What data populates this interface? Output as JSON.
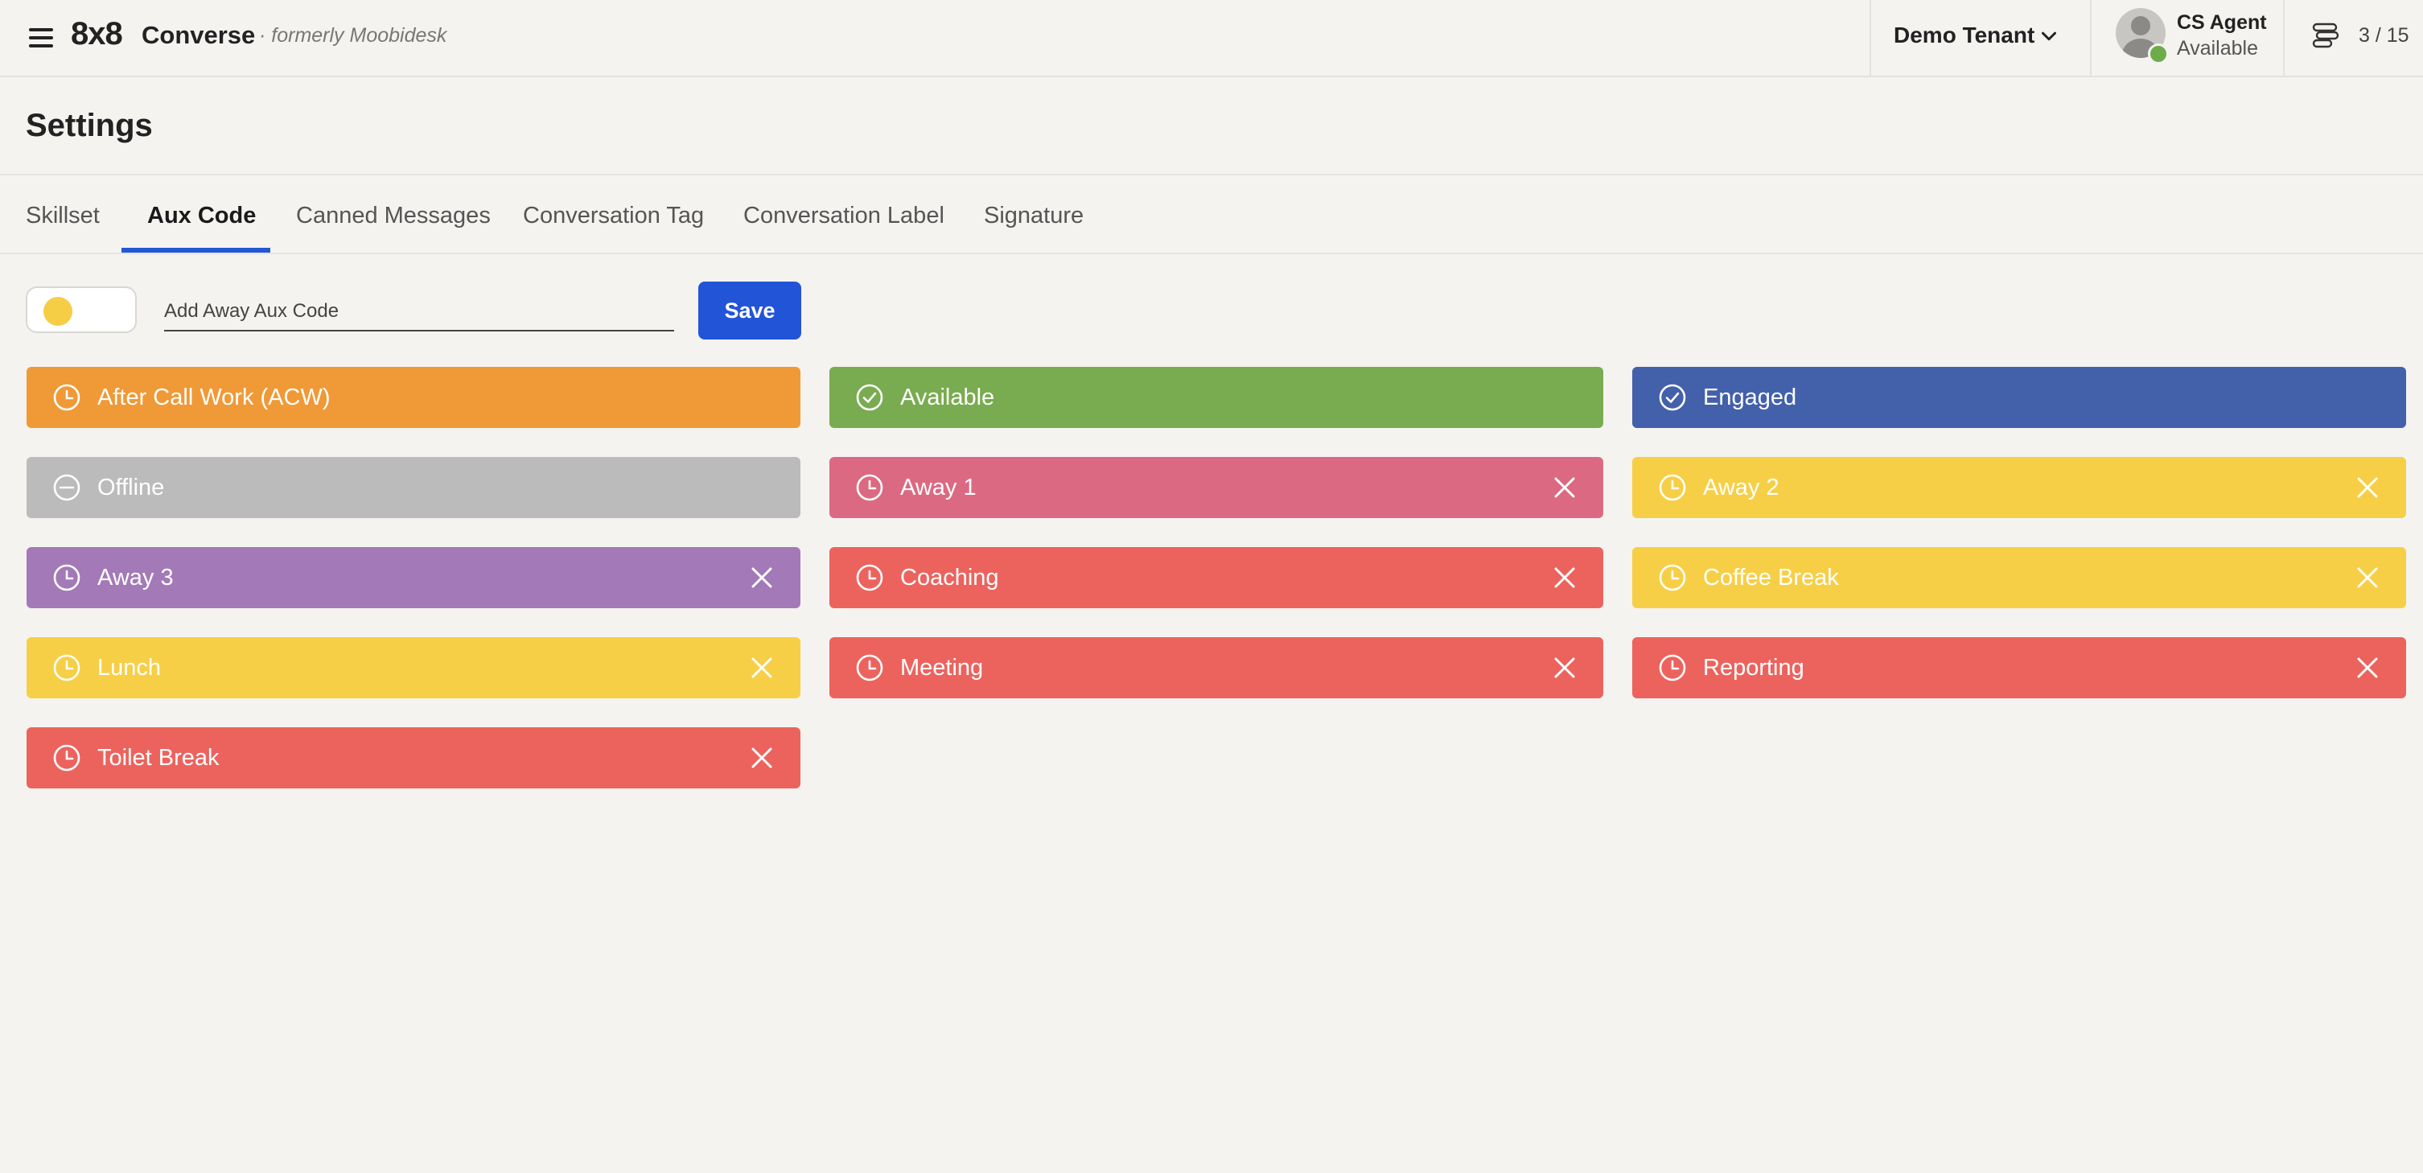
{
  "header": {
    "brand": "8x8",
    "product": "Converse",
    "subtitle": "· formerly Moobidesk",
    "tenant": "Demo Tenant",
    "agent": {
      "name": "CS Agent",
      "status": "Available"
    },
    "queue": "3 / 15"
  },
  "page": {
    "title": "Settings"
  },
  "tabs": [
    {
      "label": "Skillset"
    },
    {
      "label": "Aux Code",
      "active": true
    },
    {
      "label": "Canned Messages"
    },
    {
      "label": "Conversation Tag"
    },
    {
      "label": "Conversation Label"
    },
    {
      "label": "Signature"
    }
  ],
  "form": {
    "toggle_color": "#f5ce45",
    "placeholder": "Add Away Aux Code",
    "save_label": "Save"
  },
  "aux_codes": [
    {
      "label": "After Call Work (ACW)",
      "icon": "clock-icon",
      "color": "#f09937",
      "removable": false
    },
    {
      "label": "Available",
      "icon": "check-circle-icon",
      "color": "#79ab50",
      "removable": false
    },
    {
      "label": "Engaged",
      "icon": "check-circle-icon",
      "color": "#4360ab",
      "removable": false
    },
    {
      "label": "Offline",
      "icon": "minus-circle-icon",
      "color": "#bbbbbb",
      "removable": false
    },
    {
      "label": "Away 1",
      "icon": "clock-icon",
      "color": "#dc6982",
      "removable": true
    },
    {
      "label": "Away 2",
      "icon": "clock-icon",
      "color": "#f7cf46",
      "removable": true
    },
    {
      "label": "Away 3",
      "icon": "clock-icon",
      "color": "#a479b7",
      "removable": true
    },
    {
      "label": "Coaching",
      "icon": "clock-icon",
      "color": "#ec635e",
      "removable": true
    },
    {
      "label": "Coffee Break",
      "icon": "clock-icon",
      "color": "#f7cf46",
      "removable": true
    },
    {
      "label": "Lunch",
      "icon": "clock-icon",
      "color": "#f7cf46",
      "removable": true
    },
    {
      "label": "Meeting",
      "icon": "clock-icon",
      "color": "#ec635e",
      "removable": true
    },
    {
      "label": "Reporting",
      "icon": "clock-icon",
      "color": "#ec635e",
      "removable": true
    },
    {
      "label": "Toilet Break",
      "icon": "clock-icon",
      "color": "#ec635e",
      "removable": true
    }
  ]
}
